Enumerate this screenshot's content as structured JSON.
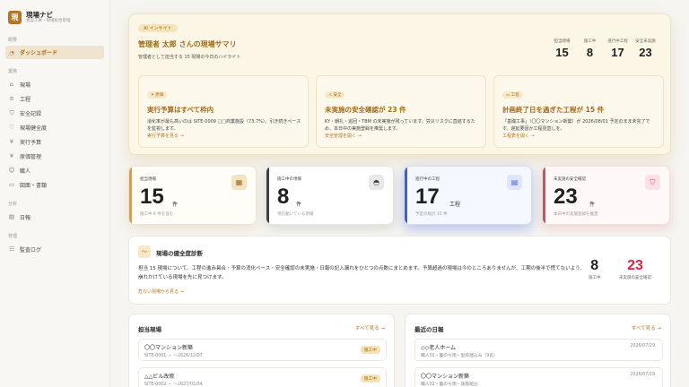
{
  "app": {
    "name": "現場ナビ",
    "subtitle": "建設工事・現場統合管理",
    "logo_char": "現"
  },
  "sidebar": {
    "sections": [
      {
        "label": "概要",
        "items": [
          {
            "label": "ダッシュボード",
            "icon": "dashboard-icon",
            "active": true
          }
        ]
      },
      {
        "label": "業務",
        "items": [
          {
            "label": "現場",
            "icon": "building-icon"
          },
          {
            "label": "工程",
            "icon": "schedule-icon"
          },
          {
            "label": "安全記録",
            "icon": "shield-icon"
          },
          {
            "label": "現場健全度",
            "icon": "health-icon"
          },
          {
            "label": "実行予算",
            "icon": "yen-icon"
          },
          {
            "label": "原価管理",
            "icon": "yen-icon"
          },
          {
            "label": "職人",
            "icon": "people-icon"
          },
          {
            "label": "図面・書類",
            "icon": "document-icon"
          }
        ]
      },
      {
        "label": "分析",
        "items": [
          {
            "label": "日報",
            "icon": "report-icon"
          }
        ]
      },
      {
        "label": "管理",
        "items": [
          {
            "label": "監査ログ",
            "icon": "log-icon"
          }
        ]
      }
    ]
  },
  "summary": {
    "badge": "AI インサイト",
    "title": "管理者 太郎 さんの現場サマリ",
    "subtitle": "管理者として担当する 15 現場の今日のハイライト",
    "kpis": [
      {
        "label": "担当現場",
        "value": "15"
      },
      {
        "label": "施工中",
        "value": "8"
      },
      {
        "label": "進行中工程",
        "value": "17"
      },
      {
        "label": "安全未実施",
        "value": "23"
      }
    ],
    "cards": [
      {
        "tag": "✦ 原価",
        "title": "実行予算はすべて枠内",
        "body": "消化率が最も高いのは SITE-0009 □□商業施設（73.7%）。引き続きペースを監視します。",
        "link": "実行予算を見る →"
      },
      {
        "tag": "⚠ 安全",
        "title": "未実施の安全確認が 23 件",
        "body": "KY・朝礼・巡回・TBM の未実施が残っています。労災リスクに直結するため、本日中の実施登録を推奨します。",
        "link": "安全管理を開く →"
      },
      {
        "tag": "▭ 工程",
        "title": "計画終了日を過ぎた工程が 15 件",
        "body": "「基礎工事」（〇〇マンション新築）が 2026/08/01 予定のまま未完了です。遅延要因か工程見直しを。",
        "link": "工程表を開く →"
      }
    ]
  },
  "stats": [
    {
      "label": "担当現場",
      "value": "15",
      "unit": "件",
      "note": "施工中 8 件を含む",
      "icon": "building-icon",
      "glyph": "▦"
    },
    {
      "label": "施工中の現場",
      "value": "8",
      "unit": "件",
      "note": "現在動いている現場",
      "icon": "helmet-icon",
      "glyph": "◓"
    },
    {
      "label": "進行中の工程",
      "value": "17",
      "unit": "工程",
      "note": "予定の総計 15 件",
      "icon": "calendar-icon",
      "glyph": "▤"
    },
    {
      "label": "未実施の安全確認",
      "value": "23",
      "unit": "件",
      "note": "本日中の実施登録を推奨",
      "icon": "shield-icon",
      "glyph": "⛉"
    }
  ],
  "health": {
    "title": "現場の健全度診断",
    "body": "担当 15 現場について、工程の進み具合・予算の消化ペース・安全確認の未実施・日報の記入漏れをひとつの点数にまとめます。予算超過の現場は今のところありませんが、工期の後半で慌てないよう、崩れかけている現場を先に見つけます。",
    "link": "危ない現場から見る →",
    "stats": [
      {
        "value": "8",
        "label": "施工中",
        "color": "#222222"
      },
      {
        "value": "23",
        "label": "未実施の安全確認",
        "color": "#d7263d"
      }
    ]
  },
  "sites_panel": {
    "title": "担当現場",
    "link": "すべて見る →",
    "rows": [
      {
        "title": "〇〇マンション新築",
        "sub": "SITE-0001 ・ 〜2026/12/07",
        "badge": "施工中"
      },
      {
        "title": "△△ビル改修",
        "sub": "SITE-0002 ・ 〜2027/01/04",
        "badge": "施工中"
      }
    ]
  },
  "reports_panel": {
    "title": "最近の日報",
    "link": "すべて見る →",
    "rows": [
      {
        "title": "◇◇老人ホーム",
        "sub": "職人01・曇のち雨・型枠建込み（9名）",
        "date": "2026/07/29"
      },
      {
        "title": "〇〇マンション新築",
        "sub": "職人02・曇のち雨・鉄筋組立",
        "date": "2026/07/29"
      }
    ]
  }
}
